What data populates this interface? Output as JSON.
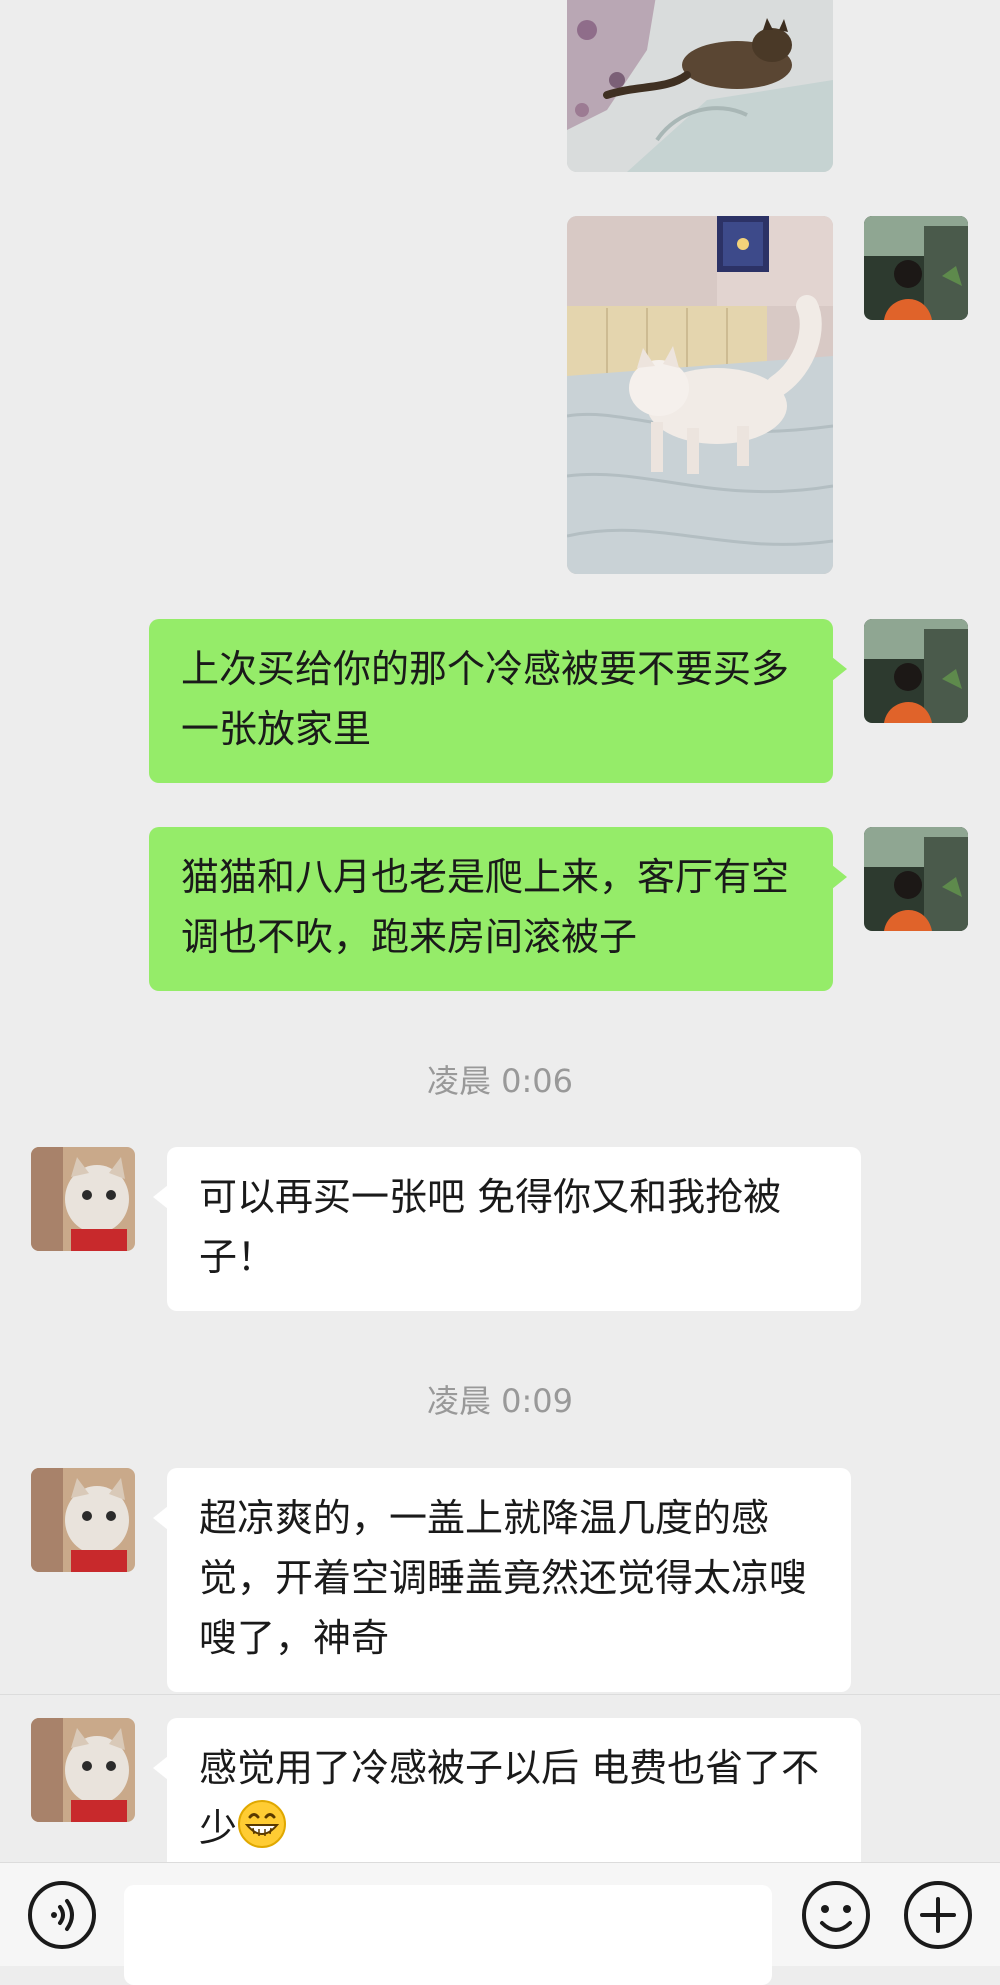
{
  "chat": {
    "messages": [
      {
        "type": "image",
        "side": "out",
        "alt": "tabby cat lying on bed"
      },
      {
        "type": "image",
        "side": "out",
        "alt": "white cat walking on cooling blanket"
      },
      {
        "type": "text",
        "side": "out",
        "text": "上次买给你的那个冷感被要不要买多一张放家里"
      },
      {
        "type": "text",
        "side": "out",
        "text": "猫猫和八月也老是爬上来，客厅有空调也不吹，跑来房间滚被子"
      },
      {
        "type": "time",
        "text": "凌晨 0:06"
      },
      {
        "type": "text",
        "side": "in",
        "text": "可以再买一张吧 免得你又和我抢被子！"
      },
      {
        "type": "time",
        "text": "凌晨 0:09"
      },
      {
        "type": "text",
        "side": "in",
        "text": "超凉爽的，一盖上就降温几度的感觉，开着空调睡盖竟然还觉得太凉嗖嗖了，神奇"
      },
      {
        "type": "text",
        "side": "in",
        "text": "感觉用了冷感被子以后 电费也省了不少",
        "emoji": "grinning-face-emoji"
      }
    ]
  },
  "input_bar": {
    "voice_icon": "voice-icon",
    "input_value": "",
    "emoji_icon": "smiley-icon",
    "plus_icon": "plus-icon"
  },
  "colors": {
    "background": "#ededed",
    "outgoing_bubble": "#95ec69",
    "incoming_bubble": "#ffffff",
    "timestamp": "#999999"
  }
}
